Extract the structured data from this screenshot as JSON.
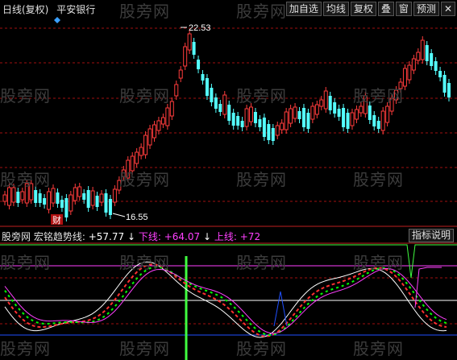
{
  "header": {
    "period_label": "日线(复权)",
    "stock_name": "平安银行"
  },
  "toolbar": {
    "items": [
      "加自选",
      "均线",
      "复权",
      "叠",
      "窗",
      "预测"
    ],
    "close_icon": "close-icon"
  },
  "watermark": "股旁网",
  "price_panel": {
    "high_label": "22.53",
    "low_label": "16.55",
    "marker_label": "财"
  },
  "indicator": {
    "source_label": "股旁网",
    "name": "宏铭趋势线:",
    "main_value": "+57.77",
    "down_label": "下线:",
    "down_value": "+64.07",
    "up_label": "上线:",
    "up_value": "+72",
    "arrow": "↓",
    "help_button": "指标说明"
  },
  "colors": {
    "background": "#000000",
    "up_candle": "#ff3c3c",
    "down_candle": "#54ffff",
    "grid": "#a01010",
    "white_line": "#ffffff",
    "red_dashed": "#ff3030",
    "green_dashed": "#00ff00",
    "magenta": "#ff40ff",
    "blue": "#2050ff",
    "green_bar": "#40ff40",
    "yellow_text": "#ffff40"
  }
}
